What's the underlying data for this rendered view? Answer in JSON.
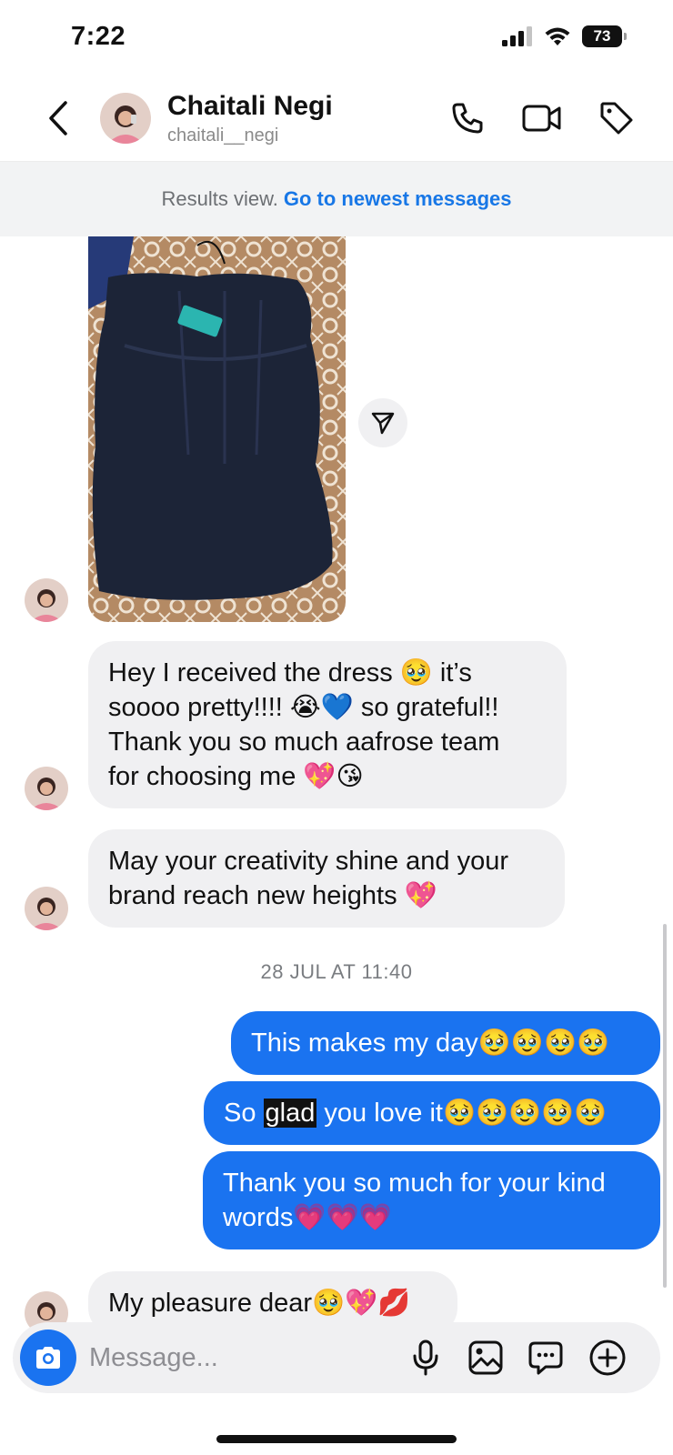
{
  "status_bar": {
    "time": "7:22",
    "battery": "73"
  },
  "header": {
    "name": "Chaitali Negi",
    "handle": "chaitali__negi"
  },
  "results_banner": {
    "label": "Results view.",
    "link": "Go to newest messages"
  },
  "messages": [
    {
      "from": "them",
      "type": "photo",
      "alt": "dress photo"
    },
    {
      "from": "them",
      "parts": [
        "Hey I received the dress 🥹 it’s",
        "soooo pretty!!!! 😭💙 so grateful!!",
        "Thank you so much aafrose team",
        "for choosing me 💖😘"
      ]
    },
    {
      "from": "them",
      "parts": [
        "May your creativity shine and your",
        "brand reach new heights 💖"
      ]
    },
    {
      "from": "me",
      "text": "This makes my day🥹🥹🥹🥹"
    },
    {
      "from": "me",
      "text_before": "So ",
      "text_highlight": "glad",
      "text_after": " you love it🥹🥹🥹🥹🥹"
    },
    {
      "from": "me",
      "parts": [
        "Thank you so much for your kind",
        "words💗💗💗"
      ]
    },
    {
      "from": "them",
      "text": "My pleasure dear🥹💖💋"
    }
  ],
  "timestamp": "28 JUL AT 11:40",
  "composer": {
    "placeholder": "Message..."
  },
  "colors": {
    "accent": "#1a73f0",
    "link": "#1877e6",
    "incoming_bubble": "#f0f0f2"
  }
}
